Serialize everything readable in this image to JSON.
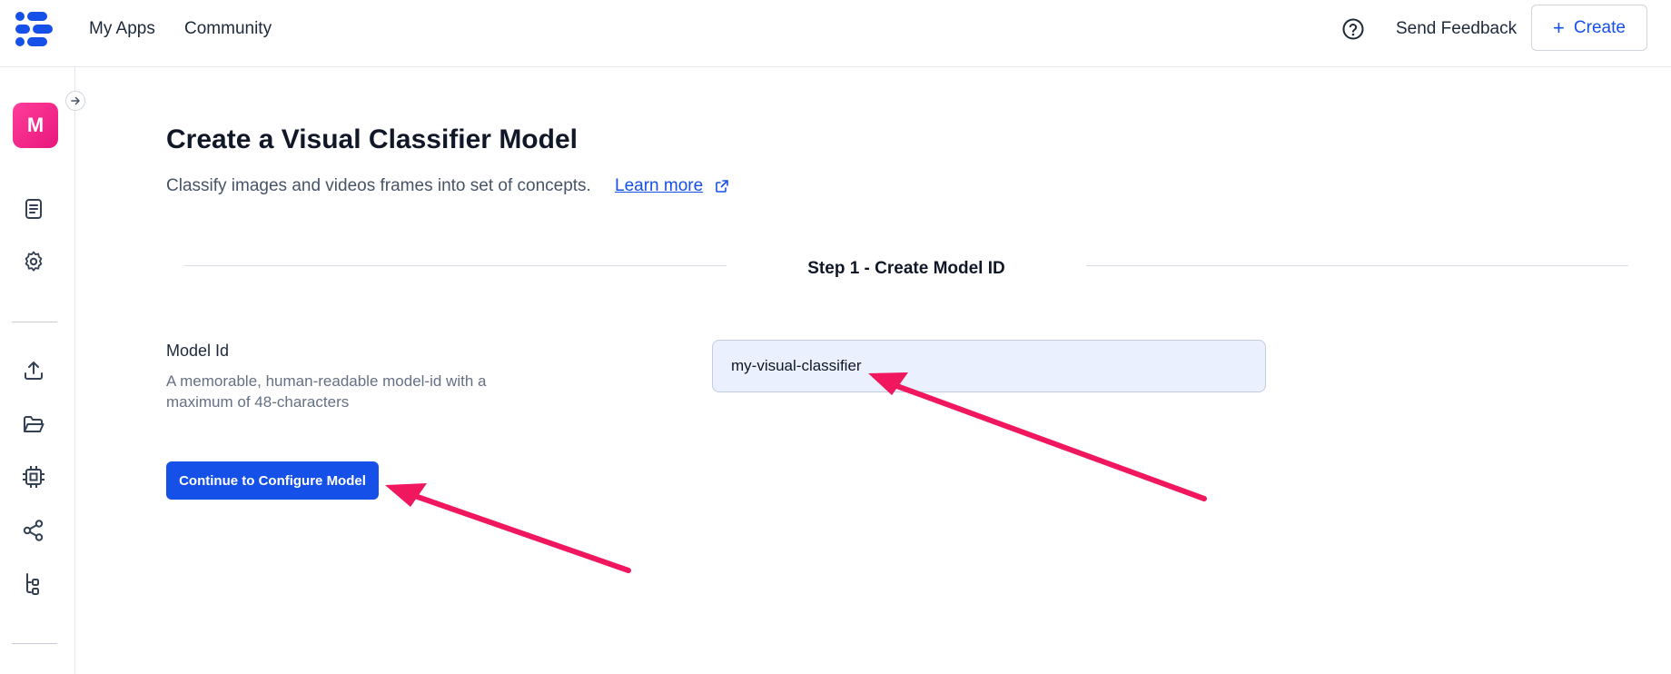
{
  "nav": {
    "links": [
      "My Apps",
      "Community"
    ],
    "feedback_label": "Send Feedback",
    "create_label": "Create"
  },
  "sidebar": {
    "avatar_letter": "M",
    "icons": [
      "document-icon",
      "gear-icon",
      "upload-icon",
      "folder-open-icon",
      "cpu-icon",
      "share-icon",
      "workflow-icon"
    ]
  },
  "main": {
    "title": "Create a Visual Classifier Model",
    "subtitle": "Classify images and videos frames into set of concepts.",
    "learn_more": "Learn more",
    "step_title": "Step 1 - Create Model ID",
    "model_id_label": "Model Id",
    "model_id_desc": "A memorable, human-readable model-id with a maximum of 48-characters",
    "model_id_value": "my-visual-classifier",
    "continue_label": "Continue to Configure Model"
  },
  "colors": {
    "accent": "#1550e8",
    "avatar": "#e8177c",
    "annotation_arrow": "#f0175f",
    "input_bg": "#eaf0fd"
  }
}
